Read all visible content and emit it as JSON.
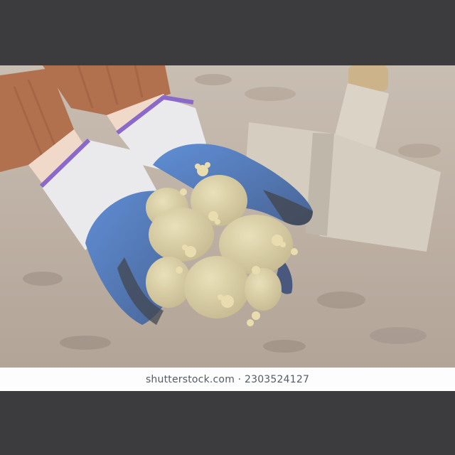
{
  "photo": {
    "subject": "gloved hands holding sprouting seed potatoes over soil with a garden shovel"
  },
  "watermark": {
    "text": "shutterstock.com · 2303524127"
  },
  "colors": {
    "letterbox": "#3c3c3e",
    "soil": "#b3a497",
    "sleeve": "#a85e36",
    "glove_palm": "#3e6fbf",
    "glove_cuff": "#e8e6ea",
    "glove_trim": "#7a55c4",
    "potato": "#d8cc9c",
    "sprout": "#e6d8a4",
    "shovel": "#cfc6b8",
    "caption_bg": "#fdfdfd",
    "caption_text": "#555a63"
  }
}
